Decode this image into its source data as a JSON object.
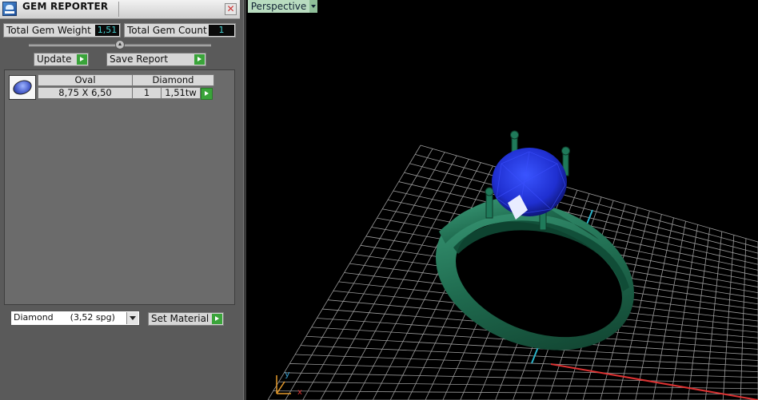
{
  "panel": {
    "title": "GEM REPORTER",
    "total_weight_label": "Total Gem Weight",
    "total_weight_value": "1,51",
    "total_count_label": "Total Gem Count",
    "total_count_value": "1",
    "update_label": "Update",
    "save_report_label": "Save Report"
  },
  "gem_table": {
    "rows": [
      {
        "shape": "Oval",
        "material": "Diamond",
        "size": "8,75 X 6,50",
        "count": "1",
        "weight": "1,51tw"
      }
    ]
  },
  "material": {
    "selected": "Diamond      (3,52 spg)",
    "set_label": "Set Material"
  },
  "viewport": {
    "view_mode": "Perspective",
    "axis_y": "y",
    "axis_x": "x"
  },
  "colors": {
    "accent_green": "#3aa43a",
    "value_cyan": "#46d0d0",
    "ring_green": "#1f6b4f",
    "stone_blue": "#1f2fd0",
    "grid": "#9a9a9a"
  },
  "icons": [
    "gem-reporter-icon",
    "close-icon",
    "play-arrow-icon",
    "dropdown-arrow-icon",
    "oval-gem-icon",
    "axis-gizmo-icon"
  ]
}
